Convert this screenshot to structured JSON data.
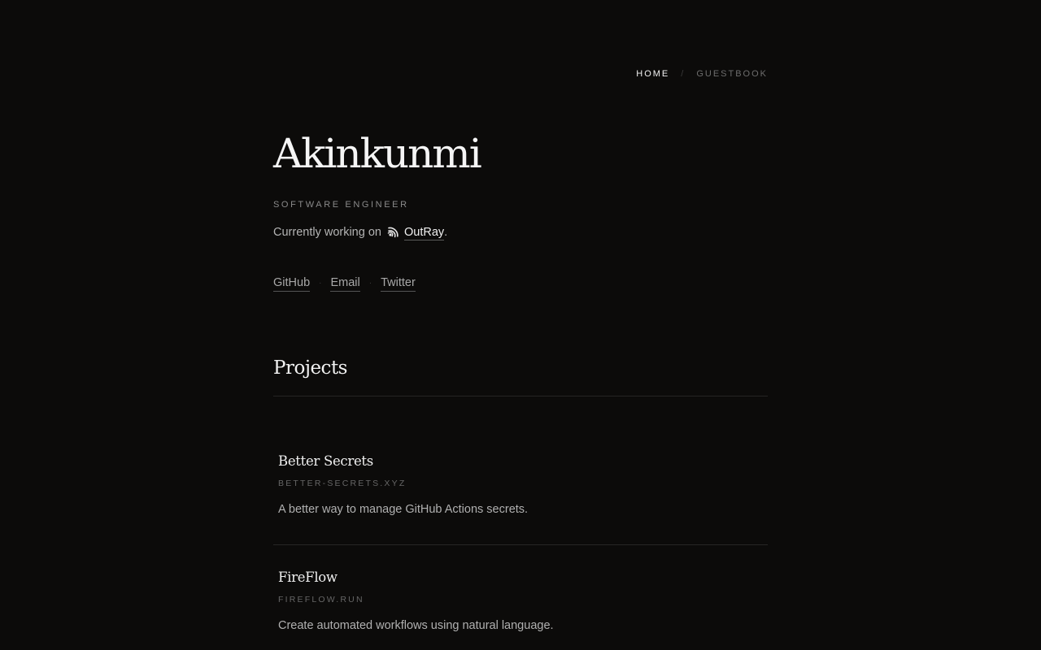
{
  "nav": {
    "home_label": "HOME",
    "separator": "/",
    "guestbook_label": "GUESTBOOK"
  },
  "profile": {
    "name": "Akinkunmi",
    "role": "SOFTWARE ENGINEER",
    "working_prefix": "Currently working on",
    "working_icon": "outray-logo-icon",
    "working_project": "OutRay",
    "working_suffix": "."
  },
  "socials": {
    "links": [
      "GitHub",
      "Email",
      "Twitter"
    ],
    "separator": "·"
  },
  "projects": {
    "title": "Projects",
    "items": [
      {
        "name": "Better Secrets",
        "url": "BETTER-SECRETS.XYZ",
        "description": "A better way to manage GitHub Actions secrets."
      },
      {
        "name": "FireFlow",
        "url": "FIREFLOW.RUN",
        "description": "Create automated workflows using natural language."
      }
    ]
  },
  "colors": {
    "background": "#0c0b0a",
    "text_primary": "#f5f5f5",
    "text_muted": "#8a8a8a",
    "divider": "#262524"
  }
}
